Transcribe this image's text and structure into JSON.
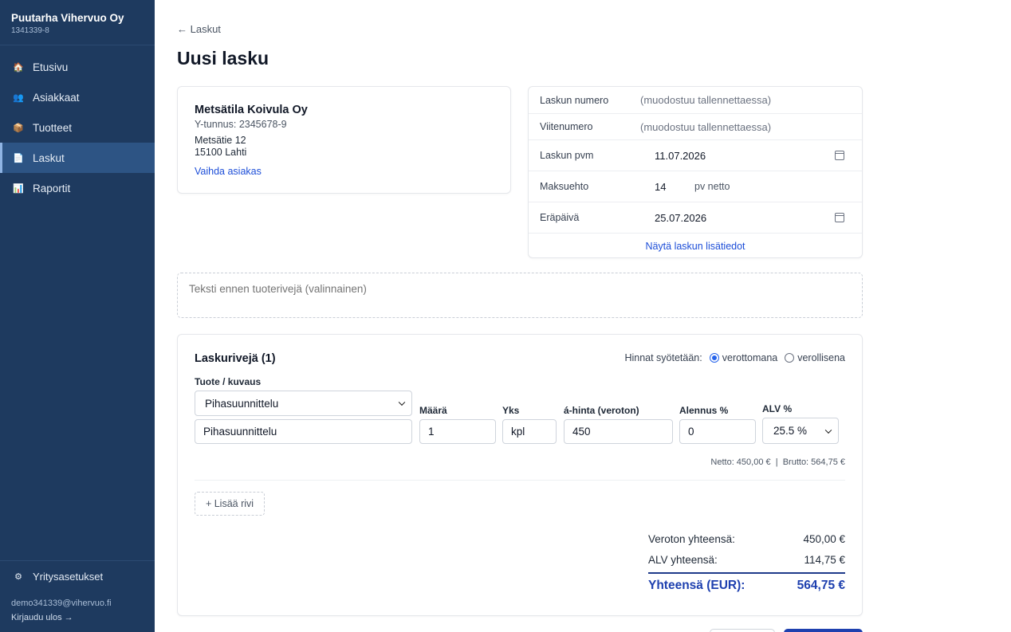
{
  "company": {
    "name": "Puutarha Vihervuo Oy",
    "id": "1341339-8"
  },
  "nav": [
    {
      "label": "Etusivu",
      "icon": "home-icon",
      "glyph": "🏠"
    },
    {
      "label": "Asiakkaat",
      "icon": "users-icon",
      "glyph": "👥"
    },
    {
      "label": "Tuotteet",
      "icon": "package-icon",
      "glyph": "📦"
    },
    {
      "label": "Laskut",
      "icon": "document-icon",
      "glyph": "📄"
    },
    {
      "label": "Raportit",
      "icon": "chart-icon",
      "glyph": "📊"
    }
  ],
  "settings": {
    "label": "Yritysasetukset",
    "icon": "gear-icon",
    "glyph": "⚙"
  },
  "user": {
    "email": "demo341339@vihervuo.fi",
    "logout": "Kirjaudu ulos →"
  },
  "back_link": "← Laskut",
  "page_title": "Uusi lasku",
  "customer": {
    "name": "Metsätila Koivula Oy",
    "ytunnus": "Y-tunnus: 2345678-9",
    "street": "Metsätie 12",
    "city": "15100 Lahti",
    "change_link": "Vaihda asiakas"
  },
  "meta": {
    "invoice_number": {
      "label": "Laskun numero",
      "value": "(muodostuu tallennettaessa)"
    },
    "reference": {
      "label": "Viitenumero",
      "value": "(muodostuu tallennettaessa)"
    },
    "invoice_date": {
      "label": "Laskun pvm",
      "value": "11.07.2026"
    },
    "payment_term": {
      "label": "Maksuehto",
      "value": "14",
      "suffix": "pv netto"
    },
    "due_date": {
      "label": "Eräpäivä",
      "value": "25.07.2026"
    },
    "more_link": "Näytä laskun lisätiedot"
  },
  "pretext_placeholder": "Teksti ennen tuoterivejä (valinnainen)",
  "rows": {
    "title": "Laskurivejä (1)",
    "price_mode_label": "Hinnat syötetään:",
    "price_mode_options": [
      "verottomana",
      "verollisena"
    ],
    "price_mode_selected": "verottomana",
    "columns": {
      "product": "Tuote / kuvaus",
      "qty": "Määrä",
      "unit": "Yks",
      "price": "á-hinta (veroton)",
      "discount": "Alennus %",
      "vat": "ALV %"
    },
    "items": [
      {
        "product_select": "Pihasuunnittelu",
        "description": "Pihasuunnittelu",
        "qty": "1",
        "unit": "kpl",
        "price": "450",
        "discount": "0",
        "vat": "25.5 %",
        "totals": "Netto: 450,00 €  |  Brutto: 564,75 €"
      }
    ],
    "add_row": "+ Lisää rivi"
  },
  "summary": {
    "net_label": "Veroton yhteensä:",
    "net_value": "450,00 €",
    "vat_label": "ALV yhteensä:",
    "vat_value": "114,75 €",
    "total_label": "Yhteensä (EUR):",
    "total_value": "564,75 €"
  },
  "colors": {
    "sidebar": "#1e3a5f",
    "accent": "#1e40af",
    "link": "#1d4ed8"
  }
}
